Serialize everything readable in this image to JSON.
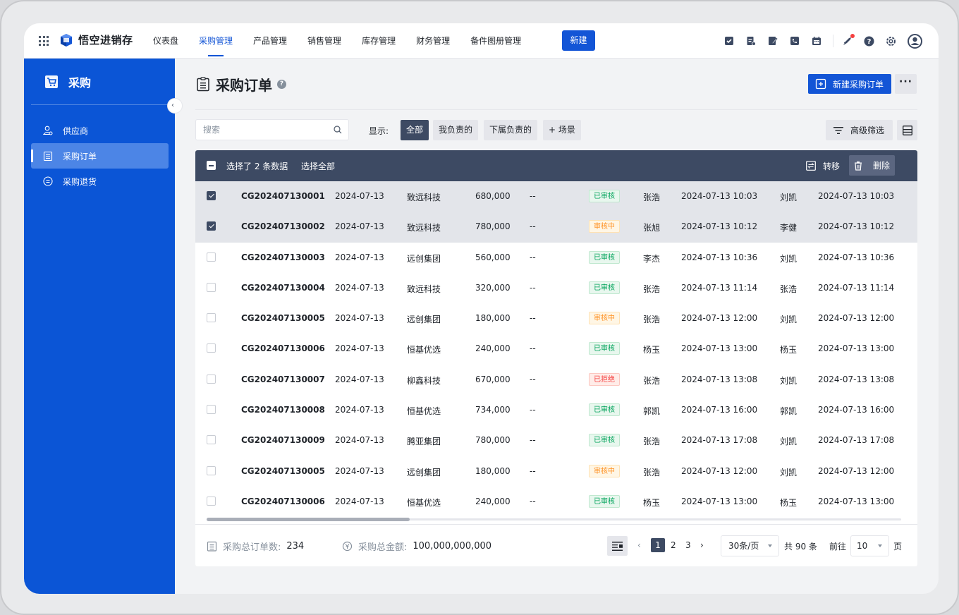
{
  "app": {
    "name": "悟空进销存"
  },
  "nav": {
    "items": [
      "仪表盘",
      "采购管理",
      "产品管理",
      "销售管理",
      "库存管理",
      "财务管理",
      "备件图册管理"
    ],
    "active": "采购管理",
    "new_label": "新建"
  },
  "toolbar_icons": [
    "check-square-icon",
    "document-icon",
    "edit-icon",
    "phone-icon",
    "calendar-icon",
    "rocket-icon",
    "help-icon",
    "settings-icon",
    "user-avatar-icon"
  ],
  "sidebar": {
    "title": "采购",
    "items": [
      {
        "label": "供应商",
        "icon": "supplier-icon"
      },
      {
        "label": "采购订单",
        "icon": "order-icon",
        "active": true
      },
      {
        "label": "采购退货",
        "icon": "return-icon"
      }
    ]
  },
  "page": {
    "title": "采购订单",
    "new_button": "新建采购订单",
    "more": "···"
  },
  "filter": {
    "search_placeholder": "搜索",
    "show_label": "显示:",
    "chips": [
      "全部",
      "我负责的",
      "下属负责的",
      "+ 场景"
    ],
    "active_chip": "全部",
    "advanced": "高级筛选"
  },
  "selection": {
    "text": "选择了 2 条数据",
    "select_all": "选择全部",
    "transfer": "转移",
    "delete": "删除"
  },
  "rows": [
    {
      "no": "CG202407130001",
      "date": "2024-07-13",
      "supplier": "致远科技",
      "amount": "680,000",
      "dash": "--",
      "status": "已审核",
      "status_type": "ok",
      "person1": "张浩",
      "time1": "2024-07-13 10:03",
      "person2": "刘凯",
      "time2": "2024-07-13 10:03",
      "selected": true
    },
    {
      "no": "CG202407130002",
      "date": "2024-07-13",
      "supplier": "致远科技",
      "amount": "780,000",
      "dash": "--",
      "status": "审核中",
      "status_type": "wait",
      "person1": "张旭",
      "time1": "2024-07-13 10:12",
      "person2": "李健",
      "time2": "2024-07-13 10:12",
      "selected": true
    },
    {
      "no": "CG202407130003",
      "date": "2024-07-13",
      "supplier": "远创集团",
      "amount": "560,000",
      "dash": "--",
      "status": "已审核",
      "status_type": "ok",
      "person1": "李杰",
      "time1": "2024-07-13 10:36",
      "person2": "刘凯",
      "time2": "2024-07-13 10:36",
      "selected": false
    },
    {
      "no": "CG202407130004",
      "date": "2024-07-13",
      "supplier": "致远科技",
      "amount": "320,000",
      "dash": "--",
      "status": "已审核",
      "status_type": "ok",
      "person1": "张浩",
      "time1": "2024-07-13 11:14",
      "person2": "张浩",
      "time2": "2024-07-13 11:14",
      "selected": false
    },
    {
      "no": "CG202407130005",
      "date": "2024-07-13",
      "supplier": "远创集团",
      "amount": "180,000",
      "dash": "--",
      "status": "审核中",
      "status_type": "wait",
      "person1": "张浩",
      "time1": "2024-07-13 12:00",
      "person2": "刘凯",
      "time2": "2024-07-13 12:00",
      "selected": false
    },
    {
      "no": "CG202407130006",
      "date": "2024-07-13",
      "supplier": "恒基优选",
      "amount": "240,000",
      "dash": "--",
      "status": "已审核",
      "status_type": "ok",
      "person1": "杨玉",
      "time1": "2024-07-13 13:00",
      "person2": "杨玉",
      "time2": "2024-07-13 13:00",
      "selected": false
    },
    {
      "no": "CG202407130007",
      "date": "2024-07-13",
      "supplier": "柳鑫科技",
      "amount": "670,000",
      "dash": "--",
      "status": "已拒绝",
      "status_type": "rej",
      "person1": "张浩",
      "time1": "2024-07-13 13:08",
      "person2": "刘凯",
      "time2": "2024-07-13 13:08",
      "selected": false
    },
    {
      "no": "CG202407130008",
      "date": "2024-07-13",
      "supplier": "恒基优选",
      "amount": "734,000",
      "dash": "--",
      "status": "已审核",
      "status_type": "ok",
      "person1": "郭凯",
      "time1": "2024-07-13 16:00",
      "person2": "郭凯",
      "time2": "2024-07-13 16:00",
      "selected": false
    },
    {
      "no": "CG202407130009",
      "date": "2024-07-13",
      "supplier": "腾亚集团",
      "amount": "780,000",
      "dash": "--",
      "status": "已审核",
      "status_type": "ok",
      "person1": "张浩",
      "time1": "2024-07-13 17:08",
      "person2": "刘凯",
      "time2": "2024-07-13 17:08",
      "selected": false
    },
    {
      "no": "CG202407130005",
      "date": "2024-07-13",
      "supplier": "远创集团",
      "amount": "180,000",
      "dash": "--",
      "status": "审核中",
      "status_type": "wait",
      "person1": "张浩",
      "time1": "2024-07-13 12:00",
      "person2": "刘凯",
      "time2": "2024-07-13 12:00",
      "selected": false
    },
    {
      "no": "CG202407130006",
      "date": "2024-07-13",
      "supplier": "恒基优选",
      "amount": "240,000",
      "dash": "--",
      "status": "已审核",
      "status_type": "ok",
      "person1": "杨玉",
      "time1": "2024-07-13 13:00",
      "person2": "杨玉",
      "time2": "2024-07-13 13:00",
      "selected": false
    }
  ],
  "footer": {
    "count_label": "采购总订单数:",
    "count_value": "234",
    "amount_label": "采购总金额:",
    "amount_value": "100,000,000,000",
    "pages": [
      "1",
      "2",
      "3"
    ],
    "current_page": "1",
    "page_size": "30条/页",
    "total": "共 90 条",
    "goto_label": "前往",
    "goto_value": "10",
    "goto_suffix": "页"
  },
  "colors": {
    "brand": "#1355d6",
    "sidebar": "#0b55d6",
    "dark_bar": "#3d4a63",
    "ok": "#00a35a",
    "wait": "#ff8f1f",
    "reject": "#f53f3f"
  }
}
